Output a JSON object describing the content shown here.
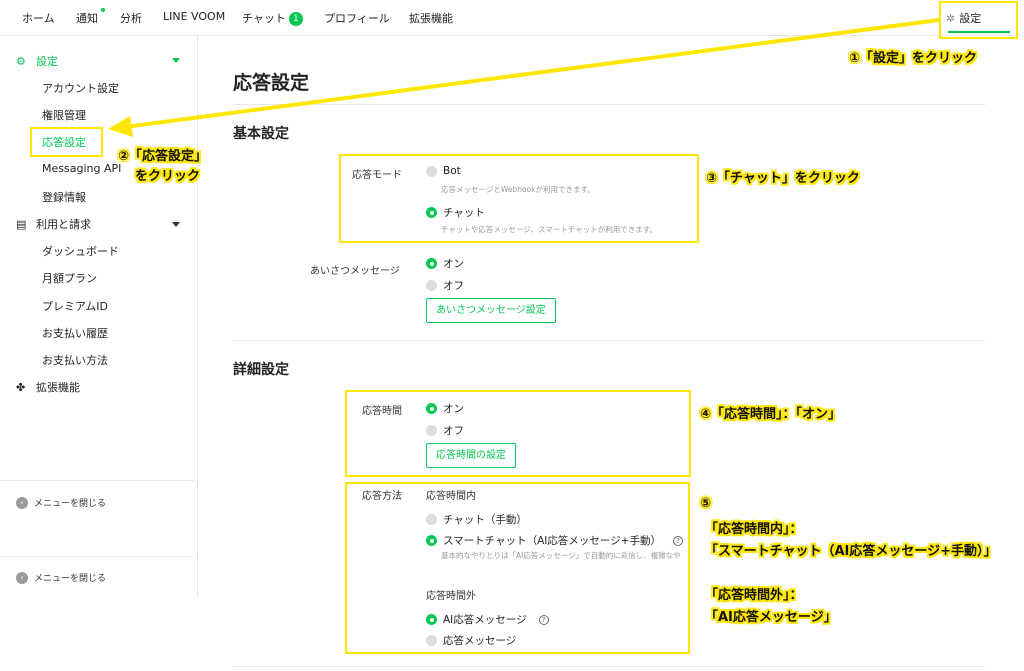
{
  "topnav": {
    "items": [
      "ホーム",
      "通知",
      "分析",
      "LINE VOOM",
      "チャット",
      "プロフィール",
      "拡張機能"
    ],
    "chat_badge": "1",
    "settings_label": "設定"
  },
  "sidebar": {
    "settings_section": "設定",
    "settings_items": [
      "アカウント設定",
      "権限管理",
      "応答設定",
      "Messaging API",
      "登録情報"
    ],
    "billing_section": "利用と請求",
    "billing_items": [
      "ダッシュボード",
      "月額プラン",
      "プレミアムID",
      "お支払い履歴",
      "お支払い方法"
    ],
    "extensions_section": "拡張機能",
    "close_menu": "メニューを閉じる"
  },
  "main": {
    "title": "応答設定",
    "basic_title": "基本設定",
    "response_mode_label": "応答モード",
    "mode_bot": "Bot",
    "mode_bot_desc": "応答メッセージとWebhookが利用できます。",
    "mode_chat": "チャット",
    "mode_chat_desc": "チャットや応答メッセージ、スマートチャットが利用できます。",
    "greeting_label": "あいさつメッセージ",
    "on": "オン",
    "off": "オフ",
    "greeting_button": "あいさつメッセージ設定",
    "detail_title": "詳細設定",
    "response_time_label": "応答時間",
    "response_time_button": "応答時間の設定",
    "response_method_label": "応答方法",
    "within_hours": "応答時間内",
    "chat_manual": "チャット（手動）",
    "smart_chat": "スマートチャット（AI応答メッセージ+手動）",
    "smart_chat_desc": "基本的なやりとりは「AI応答メッセージ」で自動的に返信し、複雑なや",
    "outside_hours": "応答時間外",
    "ai_response": "AI応答メッセージ",
    "response_message": "応答メッセージ"
  },
  "annotations": {
    "step1": "①「設定」をクリック",
    "step2a": "②「応答設定」",
    "step2b": "をクリック",
    "step3": "③「チャット」をクリック",
    "step4": "④「応答時間」：「オン」",
    "step5_num": "⑤",
    "step5a": "「応答時間内」：",
    "step5b": "「スマートチャット（AI応答メッセージ+手動）」",
    "step5c": "「応答時間外」：",
    "step5d": "「AI応答メッセージ」"
  },
  "colors": {
    "accent": "#06c755",
    "highlight": "#ffe600"
  }
}
